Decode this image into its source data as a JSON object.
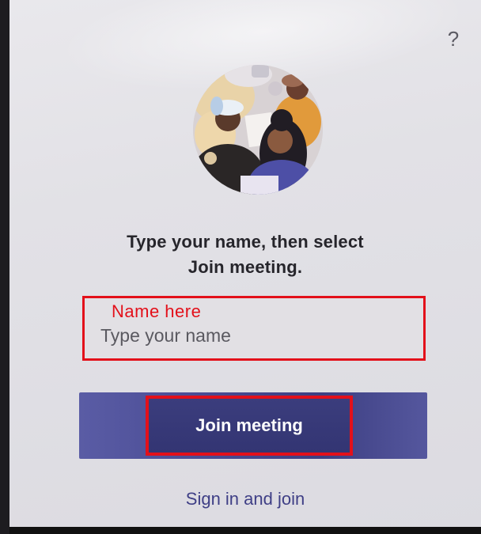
{
  "header": {
    "help_icon": "question-mark-icon",
    "help_glyph": "?"
  },
  "hero": {
    "illustration": "people-meeting-illustration"
  },
  "instruction": {
    "line1": "Type your name, then select",
    "line2": "Join meeting."
  },
  "name_field": {
    "annotation": "Name here",
    "placeholder": "Type your name",
    "value": ""
  },
  "actions": {
    "join_label": "Join meeting",
    "sign_in_label": "Sign in and join"
  },
  "colors": {
    "accent": "#464EB8",
    "annotation_red": "#E3101A",
    "link": "#3F3F86"
  }
}
